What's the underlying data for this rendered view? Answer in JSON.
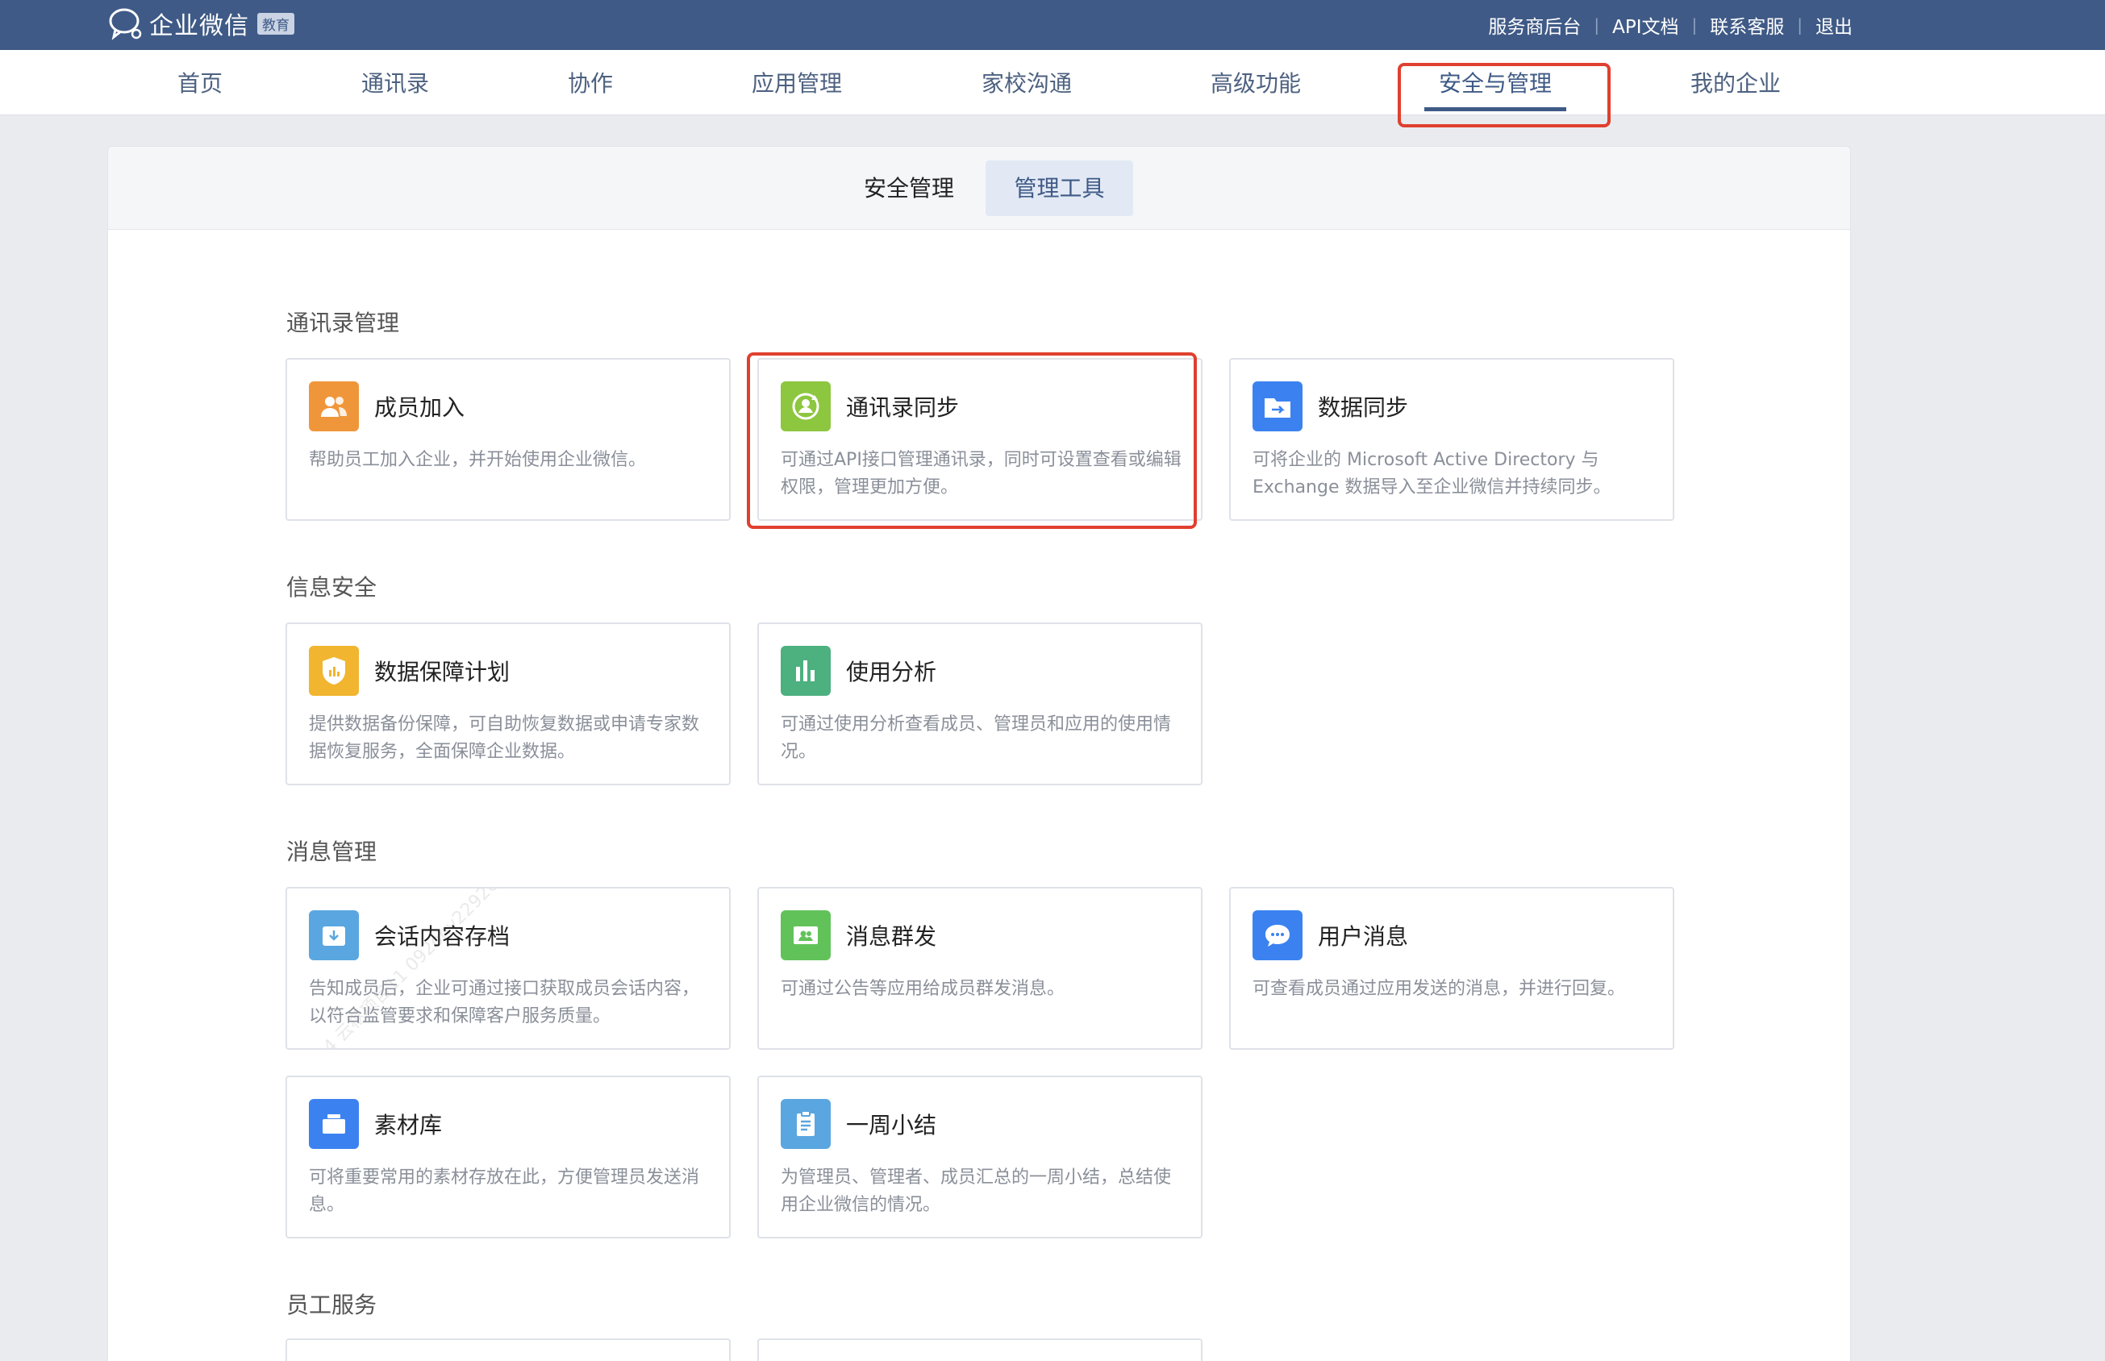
{
  "colors": {
    "topbar": "#3f5a86",
    "accent": "#3f5a86",
    "highlight_box": "#e0402f"
  },
  "header": {
    "logo_text": "企业微信",
    "logo_badge": "教育",
    "links": [
      "服务商后台",
      "API文档",
      "联系客服",
      "退出"
    ],
    "separator": "|"
  },
  "nav": {
    "items": [
      "首页",
      "通讯录",
      "协作",
      "应用管理",
      "家校沟通",
      "高级功能",
      "安全与管理",
      "我的企业"
    ],
    "active": "安全与管理"
  },
  "subnav": {
    "tabs": [
      "安全管理",
      "管理工具"
    ],
    "active": "管理工具"
  },
  "sections": [
    {
      "title": "通讯录管理",
      "cards": [
        {
          "icon": "members-icon",
          "color": "#f0963a",
          "title": "成员加入",
          "desc": "帮助员工加入企业，并开始使用企业微信。"
        },
        {
          "icon": "sync-contacts-icon",
          "color": "#8dc63f",
          "title": "通讯录同步",
          "desc": "可通过API接口管理通讯录，同时可设置查看或编辑权限，管理更加方便。"
        },
        {
          "icon": "folder-sync-icon",
          "color": "#3b82f0",
          "title": "数据同步",
          "desc": "可将企业的 Microsoft Active Directory 与 Exchange 数据导入至企业微信并持续同步。"
        }
      ]
    },
    {
      "title": "信息安全",
      "cards": [
        {
          "icon": "shield-icon",
          "color": "#f1b530",
          "title": "数据保障计划",
          "desc": "提供数据备份保障，可自助恢复数据或申请专家数据恢复服务，全面保障企业数据。"
        },
        {
          "icon": "bar-chart-icon",
          "color": "#4db07f",
          "title": "使用分析",
          "desc": "可通过使用分析查看成员、管理员和应用的使用情况。"
        }
      ]
    },
    {
      "title": "消息管理",
      "cards": [
        {
          "icon": "archive-icon",
          "color": "#5aa6e0",
          "title": "会话内容存档",
          "desc": "告知成员后，企业可通过接口获取成员会话内容，以符合监管要求和保障客户服务质量。"
        },
        {
          "icon": "broadcast-icon",
          "color": "#62c25a",
          "title": "消息群发",
          "desc": "可通过公告等应用给成员群发消息。"
        },
        {
          "icon": "chat-icon",
          "color": "#3b82f0",
          "title": "用户消息",
          "desc": "可查看成员通过应用发送的消息，并进行回复。"
        },
        {
          "icon": "library-icon",
          "color": "#3b82f0",
          "title": "素材库",
          "desc": "可将重要常用的素材存放在此，方便管理员发送消息。"
        },
        {
          "icon": "clipboard-icon",
          "color": "#5aa6e0",
          "title": "一周小结",
          "desc": "为管理员、管理者、成员汇总的一周小结，总结使用企业微信的情况。"
        }
      ]
    },
    {
      "title": "员工服务",
      "cards": []
    }
  ],
  "watermark_text": "204 云枢项目11 092ony229204 云枢项目11"
}
